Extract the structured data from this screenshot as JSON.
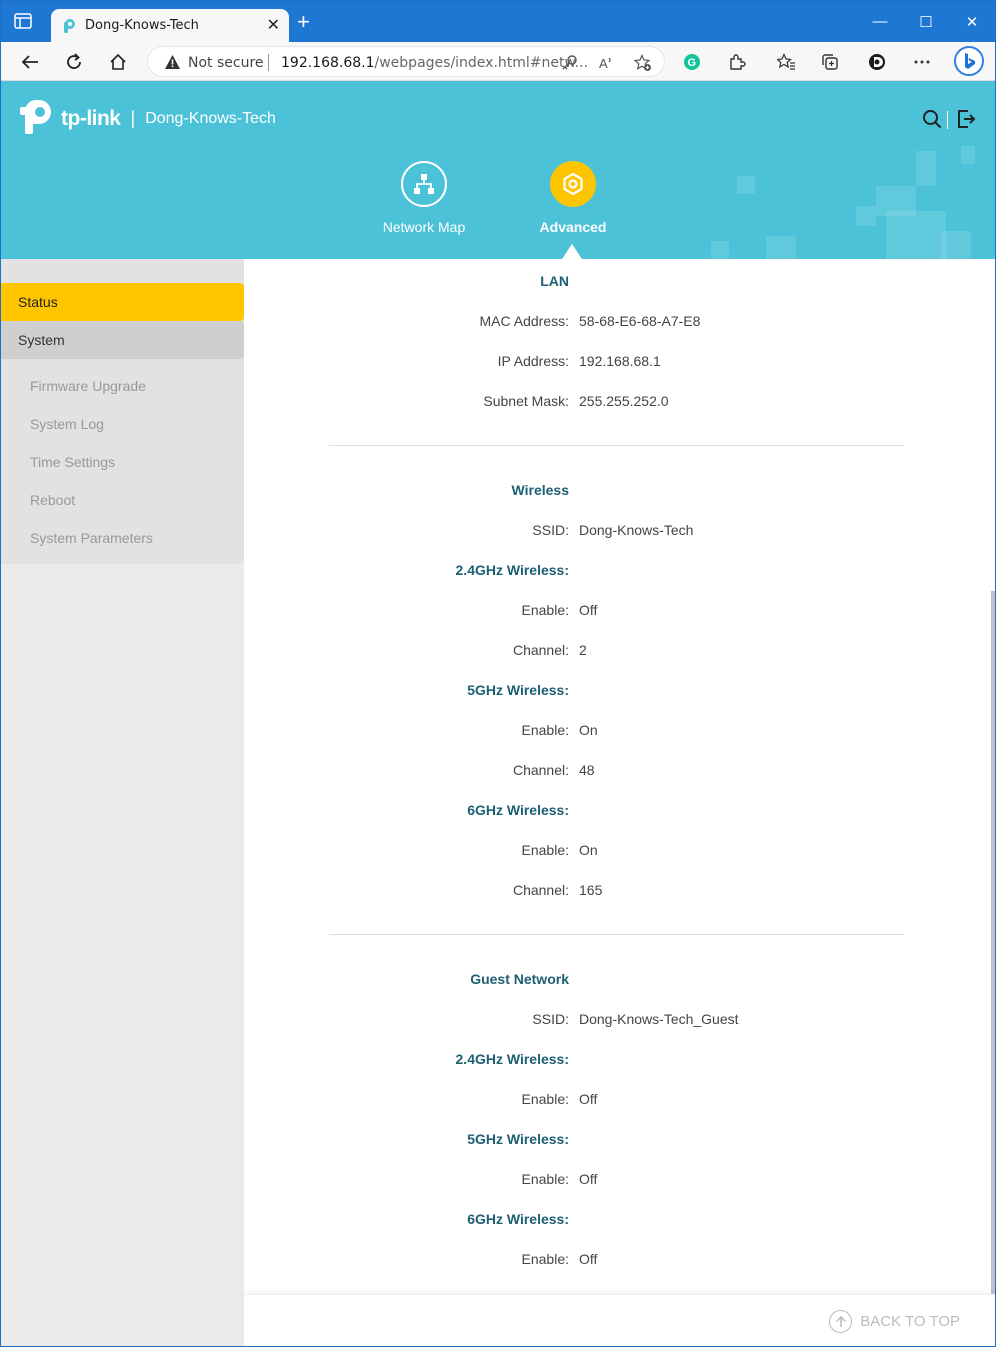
{
  "browser": {
    "tab_title": "Dong-Knows-Tech",
    "not_secure": "Not secure",
    "url_host": "192.168.68.1",
    "url_path": "/webpages/index.html#netw..."
  },
  "header": {
    "brand": "tp-link",
    "separator": "|",
    "device_name": "Dong-Knows-Tech",
    "nav": [
      {
        "label": "Network Map",
        "active": false
      },
      {
        "label": "Advanced",
        "active": true
      }
    ],
    "accent_color": "#4bc2d8",
    "active_color": "#ffc600"
  },
  "sidebar": {
    "status": "Status",
    "system": "System",
    "sub_items": [
      "Firmware Upgrade",
      "System Log",
      "Time Settings",
      "Reboot",
      "System Parameters"
    ]
  },
  "lan": {
    "title": "LAN",
    "mac_label": "MAC Address:",
    "mac_value": "58-68-E6-68-A7-E8",
    "ip_label": "IP Address:",
    "ip_value": "192.168.68.1",
    "mask_label": "Subnet Mask:",
    "mask_value": "255.255.252.0"
  },
  "wireless": {
    "title": "Wireless",
    "ssid_label": "SSID:",
    "ssid_value": "Dong-Knows-Tech",
    "band_24": "2.4GHz Wireless:",
    "enable_label": "Enable:",
    "channel_label": "Channel:",
    "b24_enable": "Off",
    "b24_channel": "2",
    "band_5": "5GHz Wireless:",
    "b5_enable": "On",
    "b5_channel": "48",
    "band_6": "6GHz Wireless:",
    "b6_enable": "On",
    "b6_channel": "165"
  },
  "guest": {
    "title": "Guest Network",
    "ssid_label": "SSID:",
    "ssid_value": "Dong-Knows-Tech_Guest",
    "band_24": "2.4GHz Wireless:",
    "enable_label": "Enable:",
    "b24_enable": "Off",
    "band_5": "5GHz Wireless:",
    "b5_enable": "Off",
    "band_6": "6GHz Wireless:",
    "b6_enable": "Off"
  },
  "footer": {
    "back_to_top": "BACK TO TOP"
  }
}
